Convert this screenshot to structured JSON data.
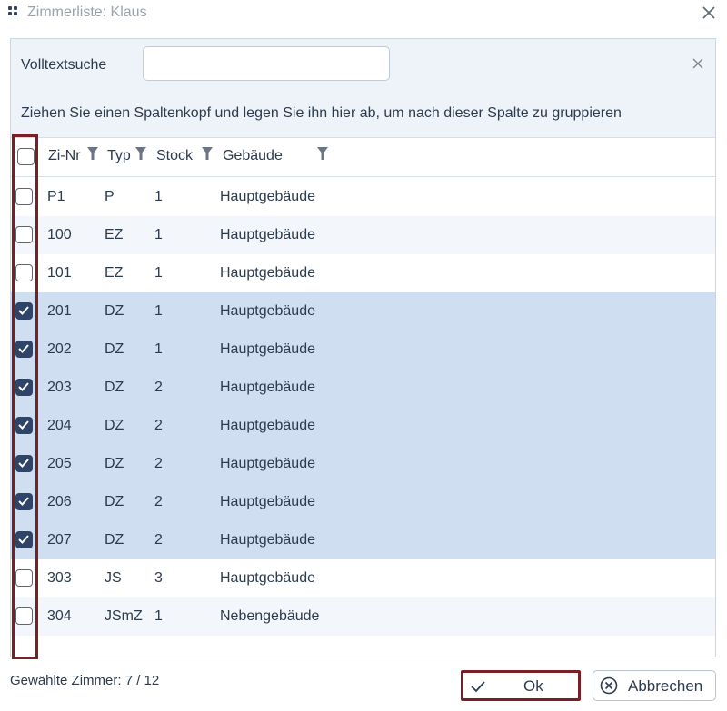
{
  "window": {
    "title": "Zimmerliste: Klaus",
    "app_icon": "app-grid-icon",
    "close_icon": "close-icon"
  },
  "search": {
    "label": "Volltextsuche",
    "value": "",
    "placeholder": "",
    "clear_icon": "close-icon"
  },
  "group_hint": "Ziehen Sie einen Spaltenkopf und legen Sie ihn hier ab, um nach dieser Spalte zu gruppieren",
  "grid": {
    "columns": [
      {
        "key": "nr",
        "label": "Zi-Nr"
      },
      {
        "key": "typ",
        "label": "Typ"
      },
      {
        "key": "stock",
        "label": "Stock"
      },
      {
        "key": "gebaeude",
        "label": "Gebäude"
      }
    ],
    "header_checked": false,
    "rows": [
      {
        "nr": "P1",
        "typ": "P",
        "stock": "1",
        "gebaeude": "Hauptgebäude",
        "checked": false
      },
      {
        "nr": "100",
        "typ": "EZ",
        "stock": "1",
        "gebaeude": "Hauptgebäude",
        "checked": false
      },
      {
        "nr": "101",
        "typ": "EZ",
        "stock": "1",
        "gebaeude": "Hauptgebäude",
        "checked": false
      },
      {
        "nr": "201",
        "typ": "DZ",
        "stock": "1",
        "gebaeude": "Hauptgebäude",
        "checked": true
      },
      {
        "nr": "202",
        "typ": "DZ",
        "stock": "1",
        "gebaeude": "Hauptgebäude",
        "checked": true
      },
      {
        "nr": "203",
        "typ": "DZ",
        "stock": "2",
        "gebaeude": "Hauptgebäude",
        "checked": true
      },
      {
        "nr": "204",
        "typ": "DZ",
        "stock": "2",
        "gebaeude": "Hauptgebäude",
        "checked": true
      },
      {
        "nr": "205",
        "typ": "DZ",
        "stock": "2",
        "gebaeude": "Hauptgebäude",
        "checked": true
      },
      {
        "nr": "206",
        "typ": "DZ",
        "stock": "2",
        "gebaeude": "Hauptgebäude",
        "checked": true
      },
      {
        "nr": "207",
        "typ": "DZ",
        "stock": "2",
        "gebaeude": "Hauptgebäude",
        "checked": true
      },
      {
        "nr": "303",
        "typ": "JS",
        "stock": "3",
        "gebaeude": "Hauptgebäude",
        "checked": false
      },
      {
        "nr": "304",
        "typ": "JSmZ",
        "stock": "1",
        "gebaeude": "Nebengebäude",
        "checked": false
      }
    ]
  },
  "footer": {
    "selected_label": "Gewählte Zimmer: 7 / 12",
    "ok_label": "Ok",
    "ok_icon": "checkmark-icon",
    "cancel_label": "Abbrechen",
    "cancel_icon": "cancel-circle-icon"
  },
  "colors": {
    "accent_dark": "#2e4468",
    "selected_row": "#cfdff1",
    "highlight_border": "#7a1f26",
    "search_zone_bg": "#eef3f9"
  }
}
